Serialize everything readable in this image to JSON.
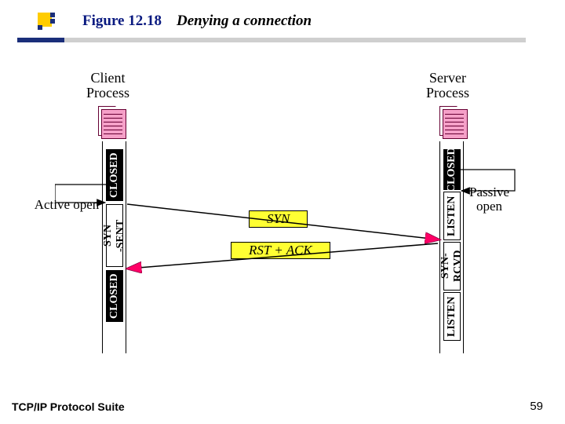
{
  "header": {
    "figure_label": "Figure 12.18",
    "figure_title": "Denying a connection"
  },
  "diagram": {
    "client_label_l1": "Client",
    "client_label_l2": "Process",
    "server_label_l1": "Server",
    "server_label_l2": "Process",
    "active_open": "Active open",
    "passive_open_l1": "Passive",
    "passive_open_l2": "open",
    "states": {
      "client": [
        "CLOSED",
        "SYN\n-SENT",
        "CLOSED"
      ],
      "server": [
        "CLOSED",
        "LISTEN",
        "SYN-\nRCVD",
        "LISTEN"
      ]
    },
    "messages": {
      "syn": "SYN",
      "rst_ack": "RST + ACK"
    }
  },
  "footer": {
    "suite": "TCP/IP Protocol Suite",
    "page": "59"
  },
  "chart_data": {
    "type": "sequence",
    "participants": [
      "Client Process",
      "Server Process"
    ],
    "client_states": [
      "CLOSED",
      "SYN-SENT",
      "CLOSED"
    ],
    "server_states": [
      "CLOSED",
      "LISTEN",
      "SYN-RCVD",
      "LISTEN"
    ],
    "events": [
      {
        "at": "Client",
        "action": "Active open"
      },
      {
        "at": "Server",
        "action": "Passive open"
      },
      {
        "from": "Client",
        "to": "Server",
        "label": "SYN"
      },
      {
        "from": "Server",
        "to": "Client",
        "label": "RST + ACK"
      }
    ],
    "title": "Denying a connection"
  }
}
